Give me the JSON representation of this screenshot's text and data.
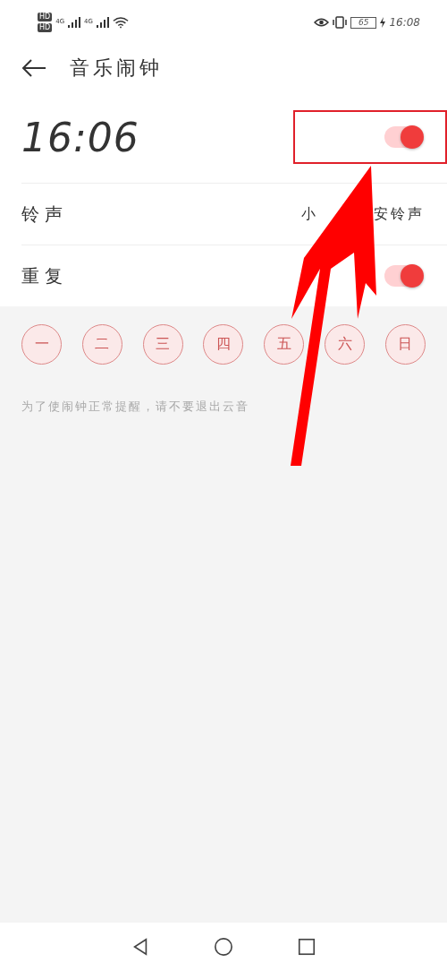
{
  "status_bar": {
    "hd": [
      "HD",
      "HD"
    ],
    "networks": [
      "4G",
      "4G"
    ],
    "battery": "65",
    "time": "16:08"
  },
  "header": {
    "title": "音乐闹钟"
  },
  "alarm": {
    "time": "16:06",
    "on": true,
    "highlighted": true
  },
  "ringtone": {
    "label": "铃声",
    "value_parts": [
      "小",
      "安铃声"
    ]
  },
  "repeat": {
    "label": "重复",
    "on": true
  },
  "days": [
    {
      "label": "一",
      "selected": false
    },
    {
      "label": "二",
      "selected": false
    },
    {
      "label": "三",
      "selected": false
    },
    {
      "label": "四",
      "selected": false
    },
    {
      "label": "五",
      "selected": false
    },
    {
      "label": "六",
      "selected": false
    },
    {
      "label": "日",
      "selected": false
    }
  ],
  "hint": "为了使闹钟正常提醒，请不要退出云音"
}
